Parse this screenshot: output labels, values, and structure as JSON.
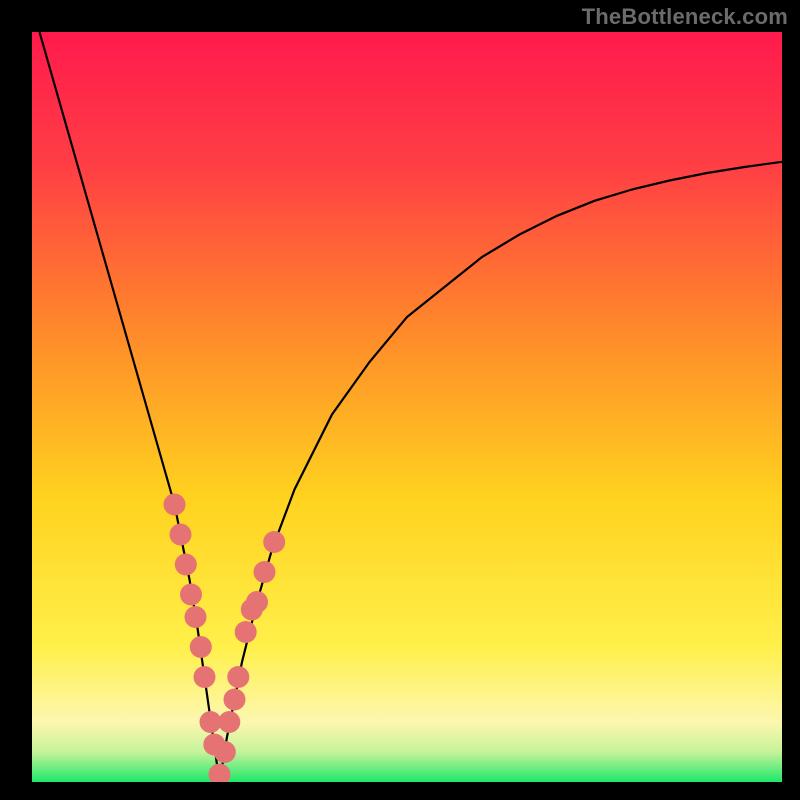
{
  "watermark": "TheBottleneck.com",
  "colors": {
    "gradient_stops": [
      {
        "offset": "0%",
        "color": "#ff1a4d"
      },
      {
        "offset": "18%",
        "color": "#ff3f44"
      },
      {
        "offset": "40%",
        "color": "#ff8a2a"
      },
      {
        "offset": "62%",
        "color": "#ffd21f"
      },
      {
        "offset": "82%",
        "color": "#fff04a"
      },
      {
        "offset": "92%",
        "color": "#fdf7b0"
      },
      {
        "offset": "96%",
        "color": "#c6f29a"
      },
      {
        "offset": "100%",
        "color": "#1ee86a"
      }
    ],
    "curve": "#000000",
    "marker": "#e57373",
    "frame": "#000000"
  },
  "chart_data": {
    "type": "line",
    "title": "",
    "xlabel": "",
    "ylabel": "",
    "xlim": [
      0,
      100
    ],
    "ylim": [
      0,
      100
    ],
    "minimum_x": 25,
    "series": [
      {
        "name": "bottleneck-curve",
        "x": [
          1,
          3,
          5,
          7,
          9,
          11,
          13,
          15,
          17,
          19,
          21,
          22,
          23,
          24,
          25,
          26,
          27,
          28,
          30,
          32,
          35,
          40,
          45,
          50,
          55,
          60,
          65,
          70,
          75,
          80,
          85,
          90,
          95,
          100
        ],
        "y": [
          100,
          93,
          86,
          79,
          72,
          65,
          58,
          51,
          44,
          37,
          27,
          21,
          14,
          7,
          0,
          6,
          11,
          16,
          24,
          31,
          39,
          49,
          56,
          62,
          66,
          70,
          73,
          75.5,
          77.5,
          79,
          80.2,
          81.2,
          82,
          82.7
        ]
      }
    ],
    "markers": {
      "name": "sample-points",
      "x": [
        19.0,
        19.8,
        20.5,
        21.2,
        21.8,
        22.5,
        23.0,
        23.8,
        24.3,
        25.0,
        25.7,
        26.3,
        27.0,
        27.5,
        28.5,
        29.3,
        30.0,
        31.0,
        32.3
      ],
      "y": [
        37.0,
        33.0,
        29.0,
        25.0,
        22.0,
        18.0,
        14.0,
        8.0,
        5.0,
        1.0,
        4.0,
        8.0,
        11.0,
        14.0,
        20.0,
        23.0,
        24.0,
        28.0,
        32.0
      ],
      "r": 8
    }
  }
}
